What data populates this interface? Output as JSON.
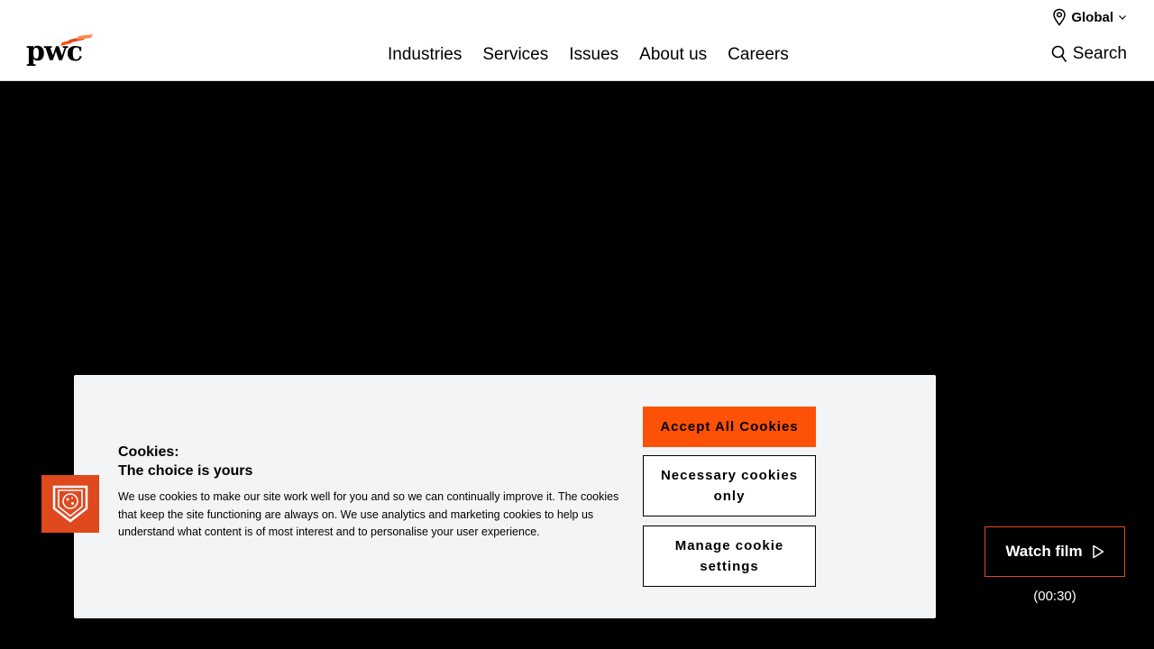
{
  "header": {
    "logo_text": "pwc",
    "region_label": "Global",
    "nav": [
      {
        "label": "Industries"
      },
      {
        "label": "Services"
      },
      {
        "label": "Issues"
      },
      {
        "label": "About us"
      },
      {
        "label": "Careers"
      }
    ],
    "search_label": "Search"
  },
  "cookie_banner": {
    "title_line1": "Cookies:",
    "title_line2": "The choice is yours",
    "text": "We use cookies to make our site work well for you and so we can continually improve it. The cookies that keep the site functioning are always on. We use analytics and marketing cookies to help us understand what content is of most interest and to personalise your user experience.",
    "accept_label": "Accept All Cookies",
    "necessary_label": "Necessary cookies only",
    "manage_label": "Manage cookie settings",
    "icon": "cookie-shield-icon"
  },
  "hero": {
    "watch_label": "Watch film",
    "duration": "(00:30)"
  },
  "colors": {
    "brand_orange": "#fd5108",
    "icon_orange": "#e0481e",
    "banner_bg": "#f3f4f6",
    "hero_bg": "#000000"
  }
}
